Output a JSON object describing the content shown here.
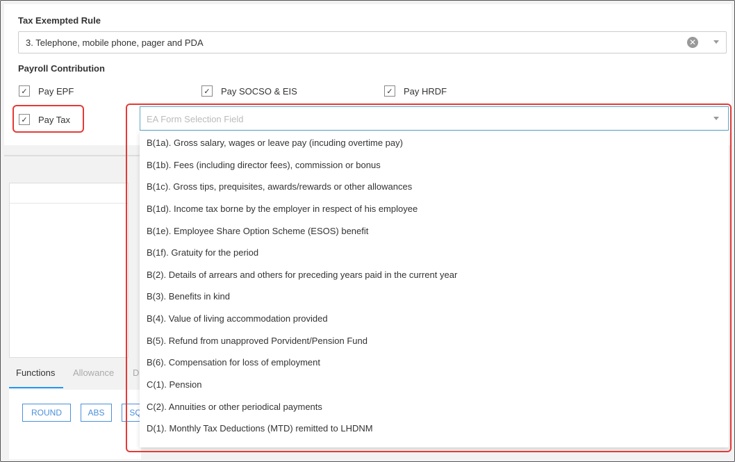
{
  "tax_exempted_rule": {
    "label": "Tax Exempted Rule",
    "selected": "3. Telephone, mobile phone, pager and PDA",
    "clear_glyph": "✕"
  },
  "payroll_contribution": {
    "label": "Payroll Contribution",
    "checkboxes": [
      {
        "label": "Pay EPF",
        "checked": true
      },
      {
        "label": "Pay SOCSO & EIS",
        "checked": true
      },
      {
        "label": "Pay HRDF",
        "checked": true
      },
      {
        "label": "Pay Tax",
        "checked": true
      }
    ],
    "check_glyph": "✓"
  },
  "ea_form": {
    "placeholder": "EA Form Selection Field",
    "options": [
      "B(1a). Gross salary, wages or leave pay (incuding overtime pay)",
      "B(1b). Fees (including director fees), commission or bonus",
      "B(1c). Gross tips, prequisites, awards/rewards or other allowances",
      "B(1d). Income tax borne by the employer in respect of his employee",
      "B(1e). Employee Share Option Scheme (ESOS) benefit",
      "B(1f). Gratuity for the period",
      "B(2). Details of arrears and others for preceding years paid in the current year",
      "B(3). Benefits in kind",
      "B(4). Value of living accommodation provided",
      "B(5). Refund from unapproved Porvident/Pension Fund",
      "B(6). Compensation for loss of employment",
      "C(1). Pension",
      "C(2). Annuities or other periodical payments",
      "D(1). Monthly Tax Deductions (MTD) remitted to LHDNM"
    ]
  },
  "tabs": {
    "functions": "Functions",
    "allowance": "Allowance",
    "clipped": "De"
  },
  "functions": {
    "round": "ROUND",
    "abs": "ABS",
    "clipped": "SQ"
  },
  "colors": {
    "highlight": "#e53935",
    "accent": "#2196f3",
    "button": "#4a90d9"
  }
}
